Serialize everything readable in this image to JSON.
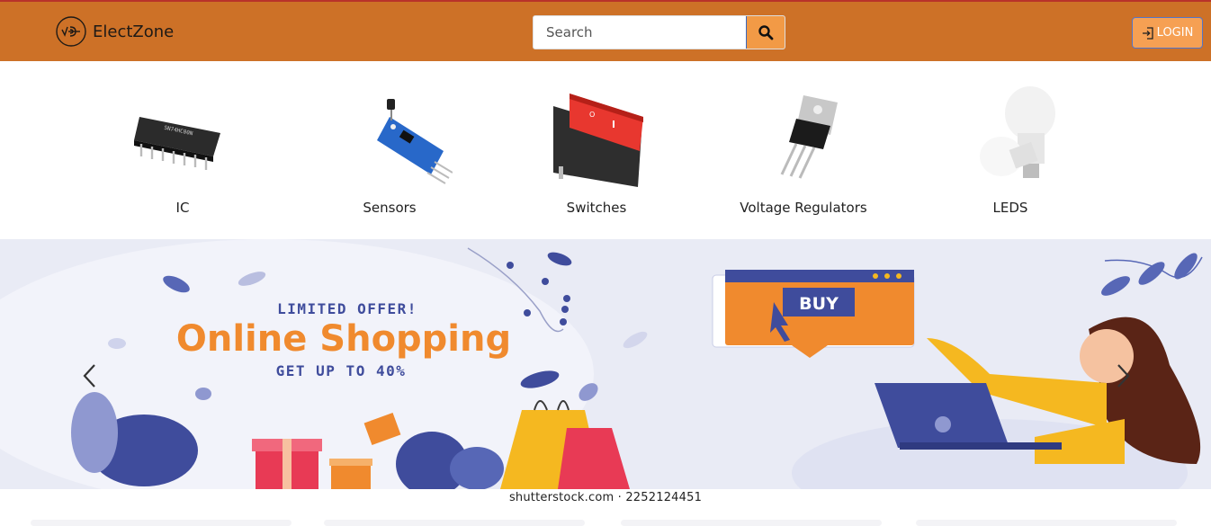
{
  "brand": {
    "name": "ElectZone",
    "logo_icon": "wave-logo-icon"
  },
  "search": {
    "placeholder": "Search",
    "value": "",
    "icon": "search-icon"
  },
  "login": {
    "label": "LOGIN",
    "icon": "sign-in-icon"
  },
  "colors": {
    "navbar": "#cd7127",
    "accent": "#f29a46",
    "banner_orange": "#f08a2e",
    "banner_blue": "#3f4c9c"
  },
  "categories": [
    {
      "label": "IC",
      "image": "ic-chip-image"
    },
    {
      "label": "Sensors",
      "image": "sensor-module-image"
    },
    {
      "label": "Switches",
      "image": "rocker-switch-image"
    },
    {
      "label": "Voltage Regulators",
      "image": "voltage-regulator-image"
    },
    {
      "label": "LEDS",
      "image": "led-bulb-image"
    }
  ],
  "banner": {
    "offer": "LIMITED OFFER!",
    "headline": "Online Shopping",
    "discount": "GET UP TO 40%",
    "buy": "BUY",
    "watermark": "shutterstock.com · 2252124451"
  },
  "carousel": {
    "prev_icon": "chevron-left-icon",
    "next_icon": "chevron-right-icon"
  }
}
